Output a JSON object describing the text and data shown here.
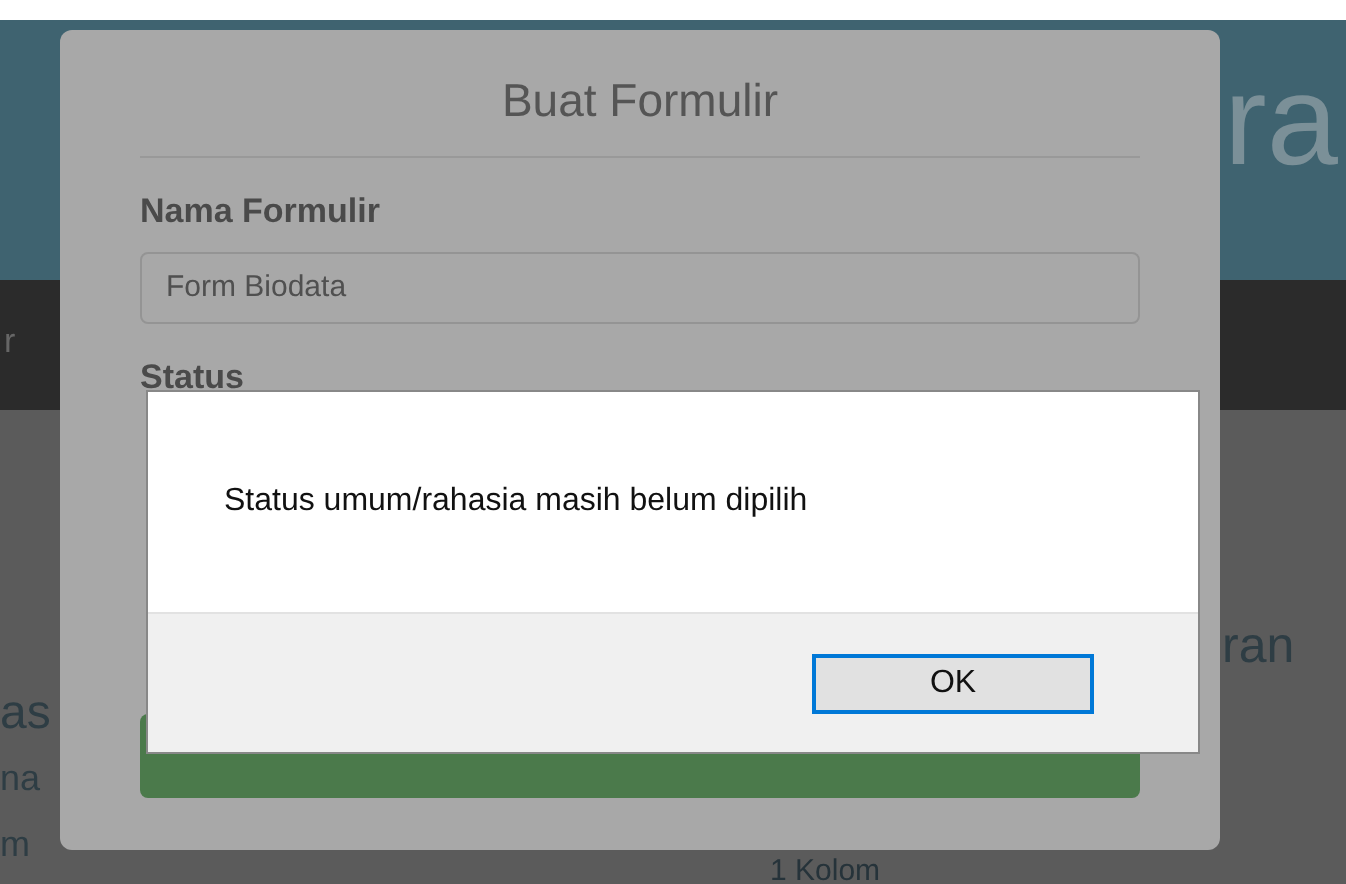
{
  "background": {
    "header_text": "ra",
    "nav_text": "r",
    "left_texts": [
      "as",
      "na",
      "m"
    ],
    "right_heading": "ran",
    "right_text": "1 Kolom"
  },
  "modal": {
    "title": "Buat Formulir",
    "fields": [
      {
        "label": "Nama Formulir",
        "value": "Form Biodata"
      }
    ],
    "status_label": "Status"
  },
  "alert": {
    "message": "Status umum/rahasia masih belum dipilih",
    "buttons": [
      {
        "label": "OK",
        "selected": true
      }
    ]
  }
}
